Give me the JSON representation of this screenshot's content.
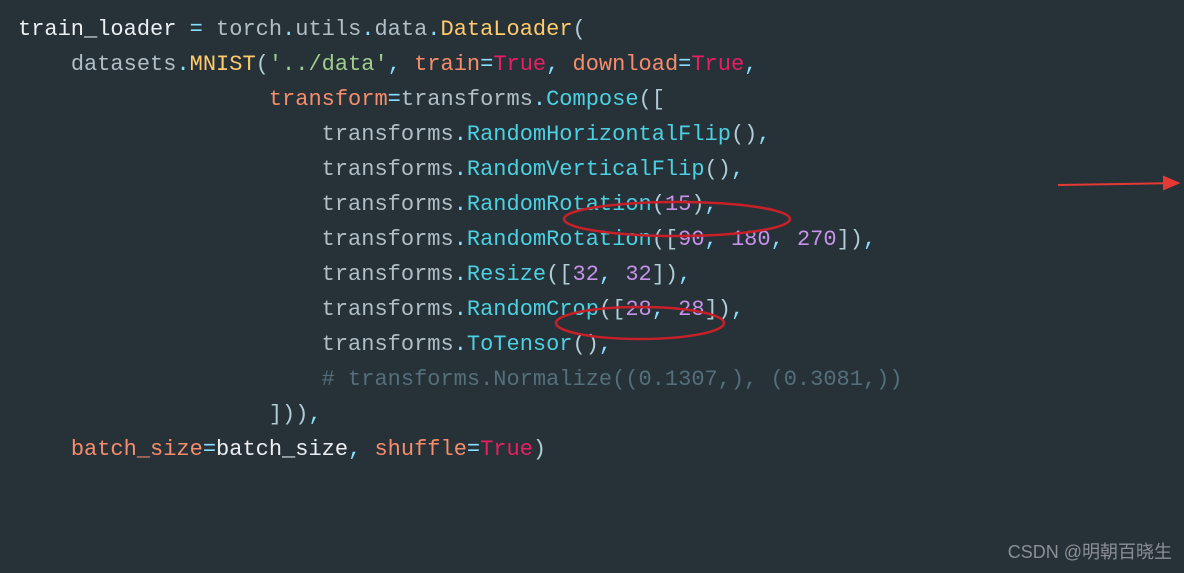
{
  "code": {
    "line1": {
      "var": "train_loader",
      "assign": " = ",
      "mod": "torch",
      "dot1": ".",
      "utils": "utils",
      "dot2": ".",
      "data_mod": "data",
      "dot3": ".",
      "cls": "DataLoader",
      "open": "("
    },
    "line2": {
      "indent": "    ",
      "mod": "datasets",
      "dot": ".",
      "cls": "MNIST",
      "open": "(",
      "str": "'../data'",
      "comma1": ", ",
      "kw1": "train",
      "eq1": "=",
      "val1": "True",
      "comma2": ", ",
      "kw2": "download",
      "eq2": "=",
      "val2": "True",
      "comma3": ","
    },
    "line3": {
      "indent": "                   ",
      "kw": "transform",
      "eq": "=",
      "mod": "transforms",
      "dot": ".",
      "method": "Compose",
      "open": "(["
    },
    "line4": {
      "indent": "                       ",
      "mod": "transforms",
      "dot": ".",
      "method": "RandomHorizontalFlip",
      "paren": "()",
      "comma": ","
    },
    "line5": {
      "indent": "                       ",
      "mod": "transforms",
      "dot": ".",
      "method": "RandomVerticalFlip",
      "paren": "()",
      "comma": ","
    },
    "line6": {
      "indent": "                       ",
      "mod": "transforms",
      "dot": ".",
      "method": "RandomRotation",
      "open": "(",
      "num": "15",
      "close": ")",
      "comma": ","
    },
    "line7": {
      "indent": "                       ",
      "mod": "transforms",
      "dot": ".",
      "method": "RandomRotation",
      "open": "([",
      "n1": "90",
      "c1": ", ",
      "n2": "180",
      "c2": ", ",
      "n3": "270",
      "close": "])",
      "comma": ","
    },
    "line8": {
      "indent": "                       ",
      "mod": "transforms",
      "dot": ".",
      "method": "Resize",
      "open": "([",
      "n1": "32",
      "c1": ", ",
      "n2": "32",
      "close": "])",
      "comma": ","
    },
    "line9": {
      "indent": "                       ",
      "mod": "transforms",
      "dot": ".",
      "method": "RandomCrop",
      "open": "([",
      "n1": "28",
      "c1": ", ",
      "n2": "28",
      "close": "])",
      "comma": ","
    },
    "line10": {
      "indent": "                       ",
      "mod": "transforms",
      "dot": ".",
      "method": "ToTensor",
      "paren": "()",
      "comma": ","
    },
    "line11": {
      "indent": "                       ",
      "comment": "# transforms.Normalize((0.1307,), (0.3081,))"
    },
    "line12": {
      "indent": "                   ",
      "close": "]))",
      "comma": ","
    },
    "line13": {
      "indent": "    ",
      "kw1": "batch_size",
      "eq1": "=",
      "val1": "batch_size",
      "comma": ", ",
      "kw2": "shuffle",
      "eq2": "=",
      "val2": "True",
      "close": ")"
    }
  },
  "watermark": "CSDN @明朝百晓生"
}
